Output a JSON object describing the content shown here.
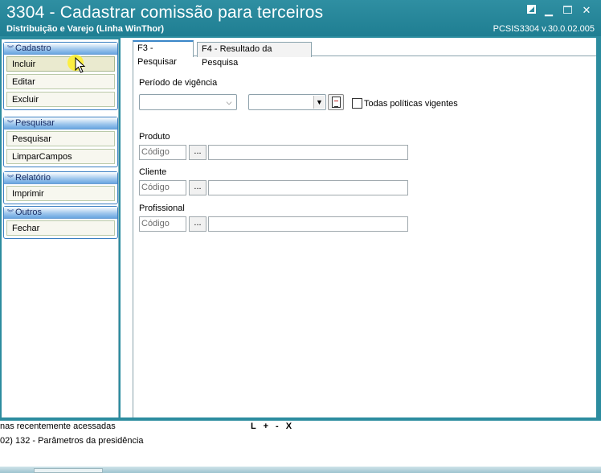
{
  "window": {
    "title": "3304 - Cadastrar comissão para terceiros",
    "subtitle": "Distribuição e Varejo (Linha WinThor)",
    "version": "PCSIS3304  v.30.0.02.005"
  },
  "sidebar": {
    "groups": [
      {
        "header": "Cadastro",
        "items": [
          "Incluir",
          "Editar",
          "Excluir"
        ]
      },
      {
        "header": "Pesquisar",
        "items": [
          "Pesquisar",
          "LimparCampos"
        ]
      },
      {
        "header": "Relatório",
        "items": [
          "Imprimir"
        ]
      },
      {
        "header": "Outros",
        "items": [
          "Fechar"
        ]
      }
    ]
  },
  "tabs": [
    {
      "label": "F3 - Pesquisar",
      "active": true
    },
    {
      "label": "F4 - Resultado da Pesquisa",
      "active": false
    }
  ],
  "form": {
    "periodo_label": "Período de vigência",
    "todas_label": "Todas políticas vigentes",
    "produto": {
      "label": "Produto",
      "placeholder": "Código",
      "btn": "..."
    },
    "cliente": {
      "label": "Cliente",
      "placeholder": "Código",
      "btn": "..."
    },
    "profissional": {
      "label": "Profissional",
      "placeholder": "Código",
      "btn": "..."
    }
  },
  "bottom": {
    "recent_title": "nas recentemente acessadas",
    "controls": "L + - X",
    "recent_item": "02)  132 - Parâmetros da presidência"
  },
  "colors": {
    "titlebar": "#2f8fa2",
    "frame": "#2c8c9f",
    "group_header": "#9cc5ec"
  }
}
